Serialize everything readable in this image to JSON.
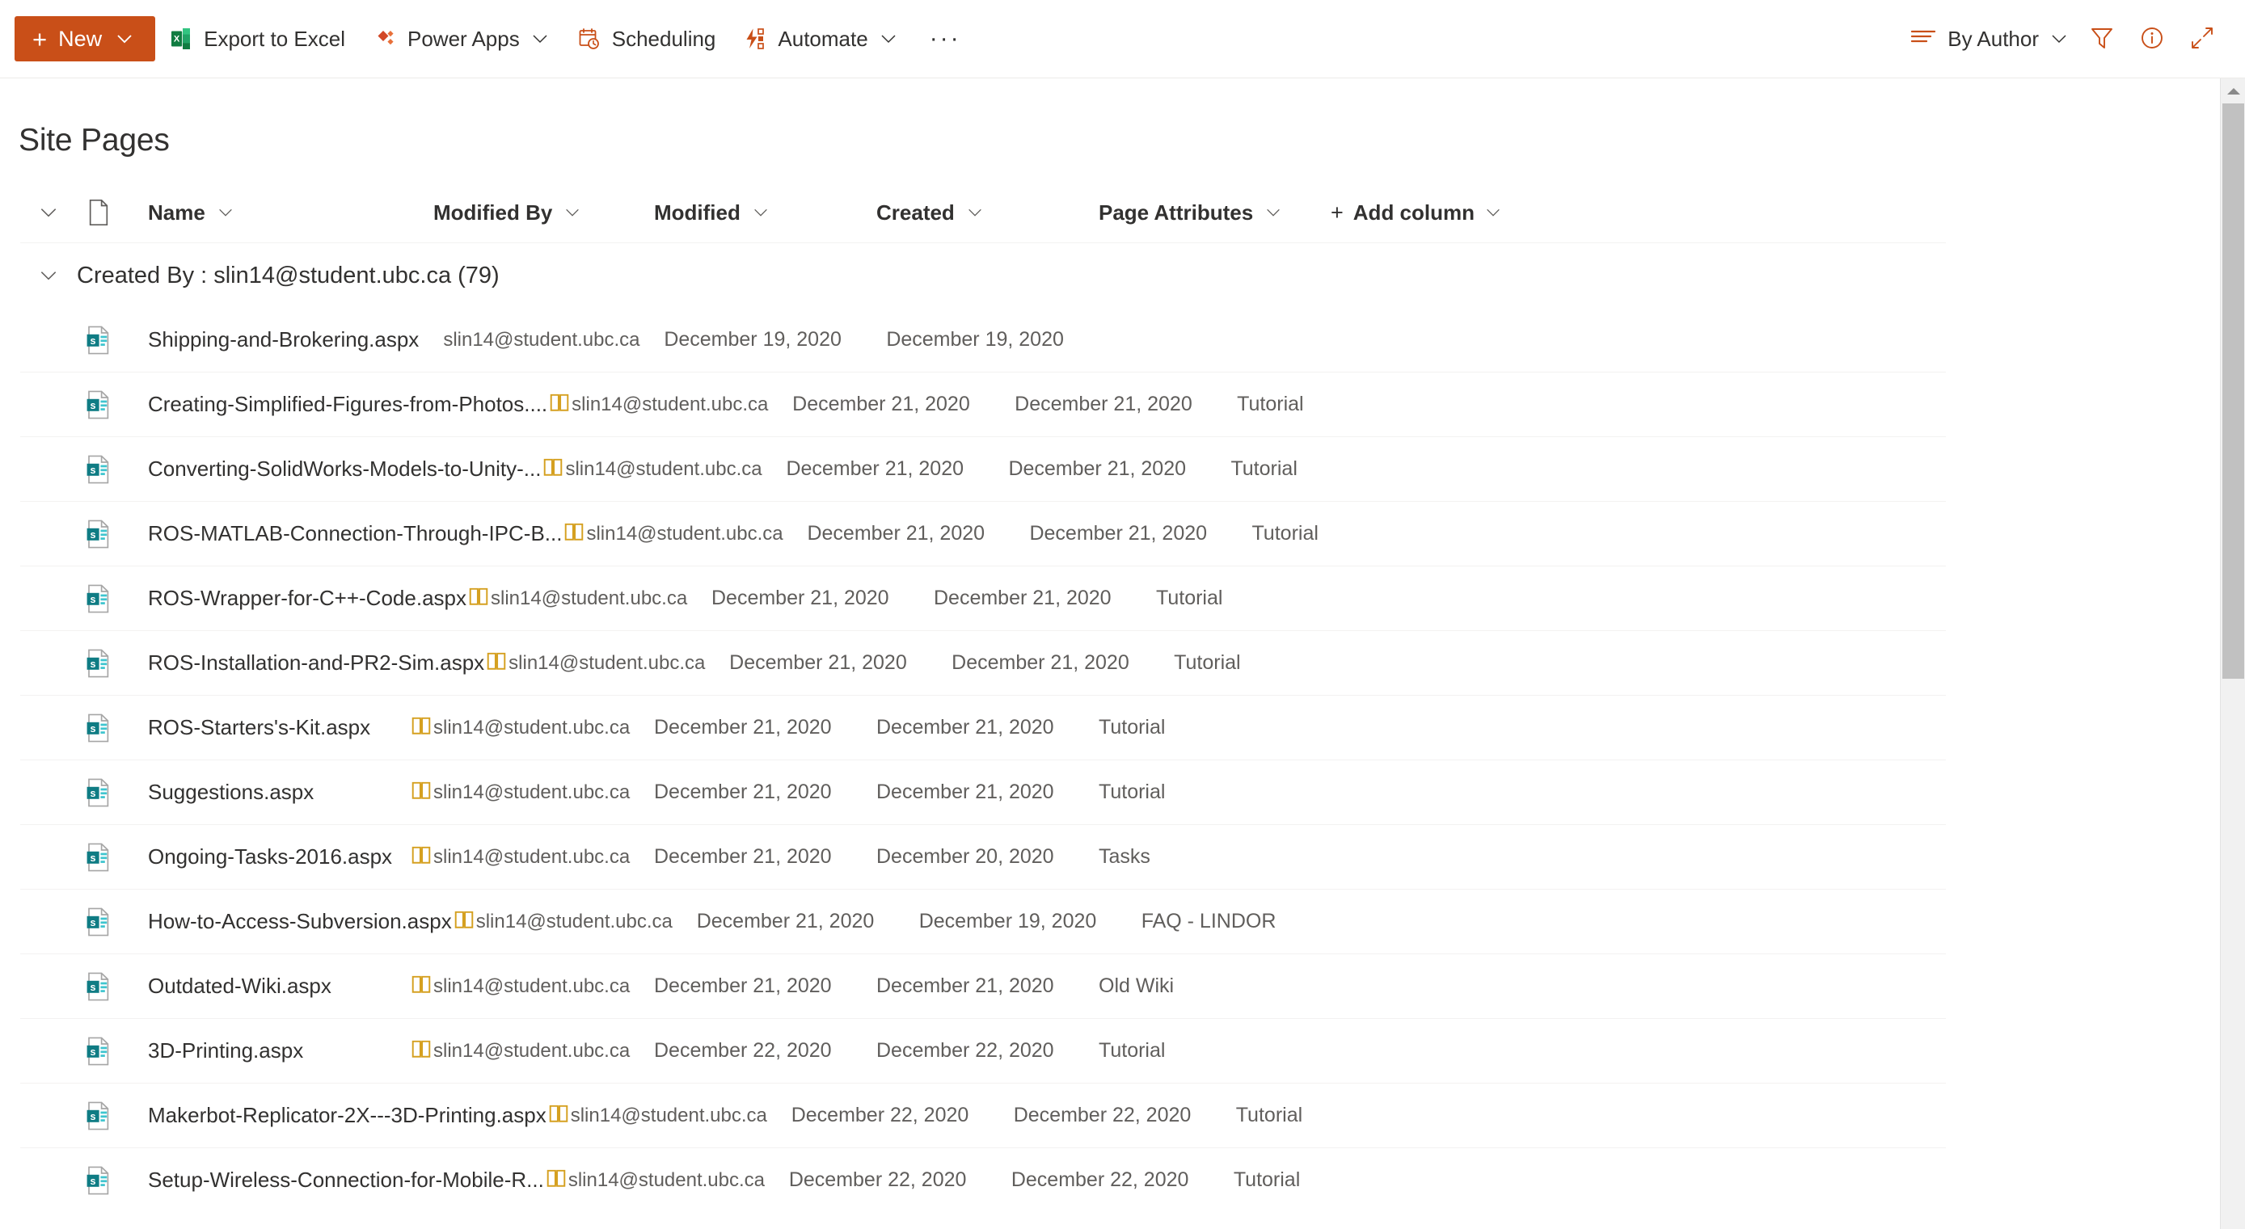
{
  "commandbar": {
    "new_label": "New",
    "items": [
      {
        "label": "Export to Excel",
        "icon": "excel-icon"
      },
      {
        "label": "Power Apps",
        "icon": "power-apps-icon",
        "has_chevron": true
      },
      {
        "label": "Scheduling",
        "icon": "calendar-clock-icon"
      },
      {
        "label": "Automate",
        "icon": "automate-icon",
        "has_chevron": true
      }
    ],
    "overflow_label": "···",
    "view_label": "By Author",
    "right_icons": [
      "filter-icon",
      "info-icon",
      "expand-icon"
    ]
  },
  "page": {
    "title": "Site Pages"
  },
  "columns": {
    "file_type_icon": "document-icon",
    "name": "Name",
    "modified_by": "Modified By",
    "modified": "Modified",
    "created": "Created",
    "page_attributes": "Page Attributes",
    "add_column": "Add column"
  },
  "group": {
    "label": "Created By : slin14@student.ubc.ca (79)",
    "expanded": true
  },
  "rows": [
    {
      "icon": "sharepoint-page-icon",
      "name": "Shipping-and-Brokering.aspx",
      "badge": "",
      "modified_by": "slin14@student.ubc.ca",
      "modified": "December 19, 2020",
      "created": "December 19, 2020",
      "attributes": ""
    },
    {
      "icon": "sharepoint-page-icon",
      "name": "Creating-Simplified-Figures-from-Photos....",
      "badge": "book-icon",
      "modified_by": "slin14@student.ubc.ca",
      "modified": "December 21, 2020",
      "created": "December 21, 2020",
      "attributes": "Tutorial"
    },
    {
      "icon": "sharepoint-page-icon",
      "name": "Converting-SolidWorks-Models-to-Unity-...",
      "badge": "book-icon",
      "modified_by": "slin14@student.ubc.ca",
      "modified": "December 21, 2020",
      "created": "December 21, 2020",
      "attributes": "Tutorial"
    },
    {
      "icon": "sharepoint-page-icon",
      "name": "ROS-MATLAB-Connection-Through-IPC-B...",
      "badge": "book-icon",
      "modified_by": "slin14@student.ubc.ca",
      "modified": "December 21, 2020",
      "created": "December 21, 2020",
      "attributes": "Tutorial"
    },
    {
      "icon": "sharepoint-page-icon",
      "name": "ROS-Wrapper-for-C++-Code.aspx",
      "badge": "book-icon",
      "modified_by": "slin14@student.ubc.ca",
      "modified": "December 21, 2020",
      "created": "December 21, 2020",
      "attributes": "Tutorial"
    },
    {
      "icon": "sharepoint-page-icon",
      "name": "ROS-Installation-and-PR2-Sim.aspx",
      "badge": "book-icon",
      "modified_by": "slin14@student.ubc.ca",
      "modified": "December 21, 2020",
      "created": "December 21, 2020",
      "attributes": "Tutorial"
    },
    {
      "icon": "sharepoint-page-icon",
      "name": "ROS-Starters's-Kit.aspx",
      "badge": "book-icon",
      "modified_by": "slin14@student.ubc.ca",
      "modified": "December 21, 2020",
      "created": "December 21, 2020",
      "attributes": "Tutorial"
    },
    {
      "icon": "sharepoint-page-icon",
      "name": "Suggestions.aspx",
      "badge": "book-icon",
      "modified_by": "slin14@student.ubc.ca",
      "modified": "December 21, 2020",
      "created": "December 21, 2020",
      "attributes": "Tutorial"
    },
    {
      "icon": "sharepoint-page-icon",
      "name": "Ongoing-Tasks-2016.aspx",
      "badge": "book-icon",
      "modified_by": "slin14@student.ubc.ca",
      "modified": "December 21, 2020",
      "created": "December 20, 2020",
      "attributes": "Tasks"
    },
    {
      "icon": "sharepoint-page-icon",
      "name": "How-to-Access-Subversion.aspx",
      "badge": "book-icon",
      "modified_by": "slin14@student.ubc.ca",
      "modified": "December 21, 2020",
      "created": "December 19, 2020",
      "attributes": "FAQ - LINDOR"
    },
    {
      "icon": "sharepoint-page-icon",
      "name": "Outdated-Wiki.aspx",
      "badge": "book-icon",
      "modified_by": "slin14@student.ubc.ca",
      "modified": "December 21, 2020",
      "created": "December 21, 2020",
      "attributes": "Old Wiki"
    },
    {
      "icon": "sharepoint-page-icon",
      "name": "3D-Printing.aspx",
      "badge": "book-icon",
      "modified_by": "slin14@student.ubc.ca",
      "modified": "December 22, 2020",
      "created": "December 22, 2020",
      "attributes": "Tutorial"
    },
    {
      "icon": "sharepoint-page-icon",
      "name": "Makerbot-Replicator-2X---3D-Printing.aspx",
      "badge": "book-icon",
      "modified_by": "slin14@student.ubc.ca",
      "modified": "December 22, 2020",
      "created": "December 22, 2020",
      "attributes": "Tutorial"
    },
    {
      "icon": "sharepoint-page-icon",
      "name": "Setup-Wireless-Connection-for-Mobile-R...",
      "badge": "book-icon",
      "modified_by": "slin14@student.ubc.ca",
      "modified": "December 22, 2020",
      "created": "December 22, 2020",
      "attributes": "Tutorial"
    }
  ],
  "colors": {
    "accent": "#c94f18",
    "sharepoint_teal": "#0f7c84",
    "badge_gold": "#d5a020",
    "text": "#323130",
    "subtle_text": "#605e5c",
    "divider": "#f3f2f1"
  }
}
